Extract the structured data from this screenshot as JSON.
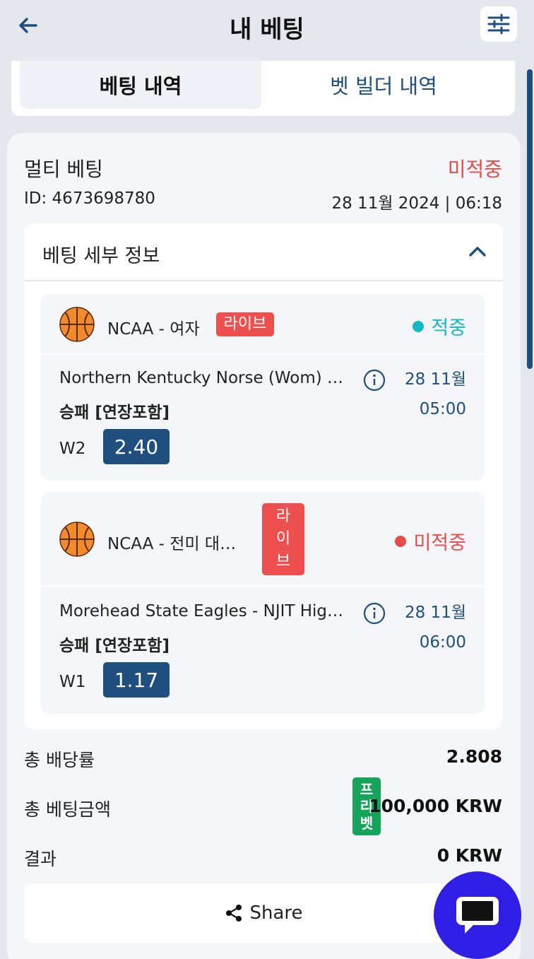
{
  "header": {
    "title": "내 베팅",
    "back_icon": "arrow-left-icon",
    "filter_icon": "sliders-icon"
  },
  "tabs": [
    {
      "label": "베팅 내역",
      "active": true
    },
    {
      "label": "벳 빌더 내역",
      "active": false
    }
  ],
  "bet": {
    "type": "멀티 베팅",
    "status": "미적중",
    "id": "ID: 4673698780",
    "datetime": "28 11월 2024 | 06:18",
    "details_title": "베팅 세부 정보",
    "events": [
      {
        "league": "NCAA - 여자",
        "live": "라이브",
        "result": "적중",
        "match": "Northern Kentucky Norse (Wom) …",
        "date": "28 11월",
        "time": "05:00",
        "market": "승패 [연장포함]",
        "selection": "W2",
        "odds": "2.40"
      },
      {
        "league": "NCAA - 전미 대…",
        "live_chars": [
          "라",
          "이",
          "브"
        ],
        "result": "미적중",
        "match": "Morehead State Eagles - NJIT Hig…",
        "date": "28 11월",
        "time": "06:00",
        "market": "승패 [연장포함]",
        "selection": "W1",
        "odds": "1.17"
      }
    ],
    "summary": {
      "total_odds_label": "총 배당률",
      "total_odds": "2.808",
      "stake_label": "총 베팅금액",
      "freebet_chars": [
        "프",
        "리",
        "벳"
      ],
      "stake": "100,000 KRW",
      "result_label": "결과",
      "result": "0 KRW"
    },
    "share_label": "Share"
  },
  "colors": {
    "accent": "#1f4f7f",
    "lost": "#e94a4a",
    "won": "#14b8c4",
    "live": "#ee4f4f",
    "freebet": "#16a35a",
    "chat": "#2f1ee6"
  }
}
